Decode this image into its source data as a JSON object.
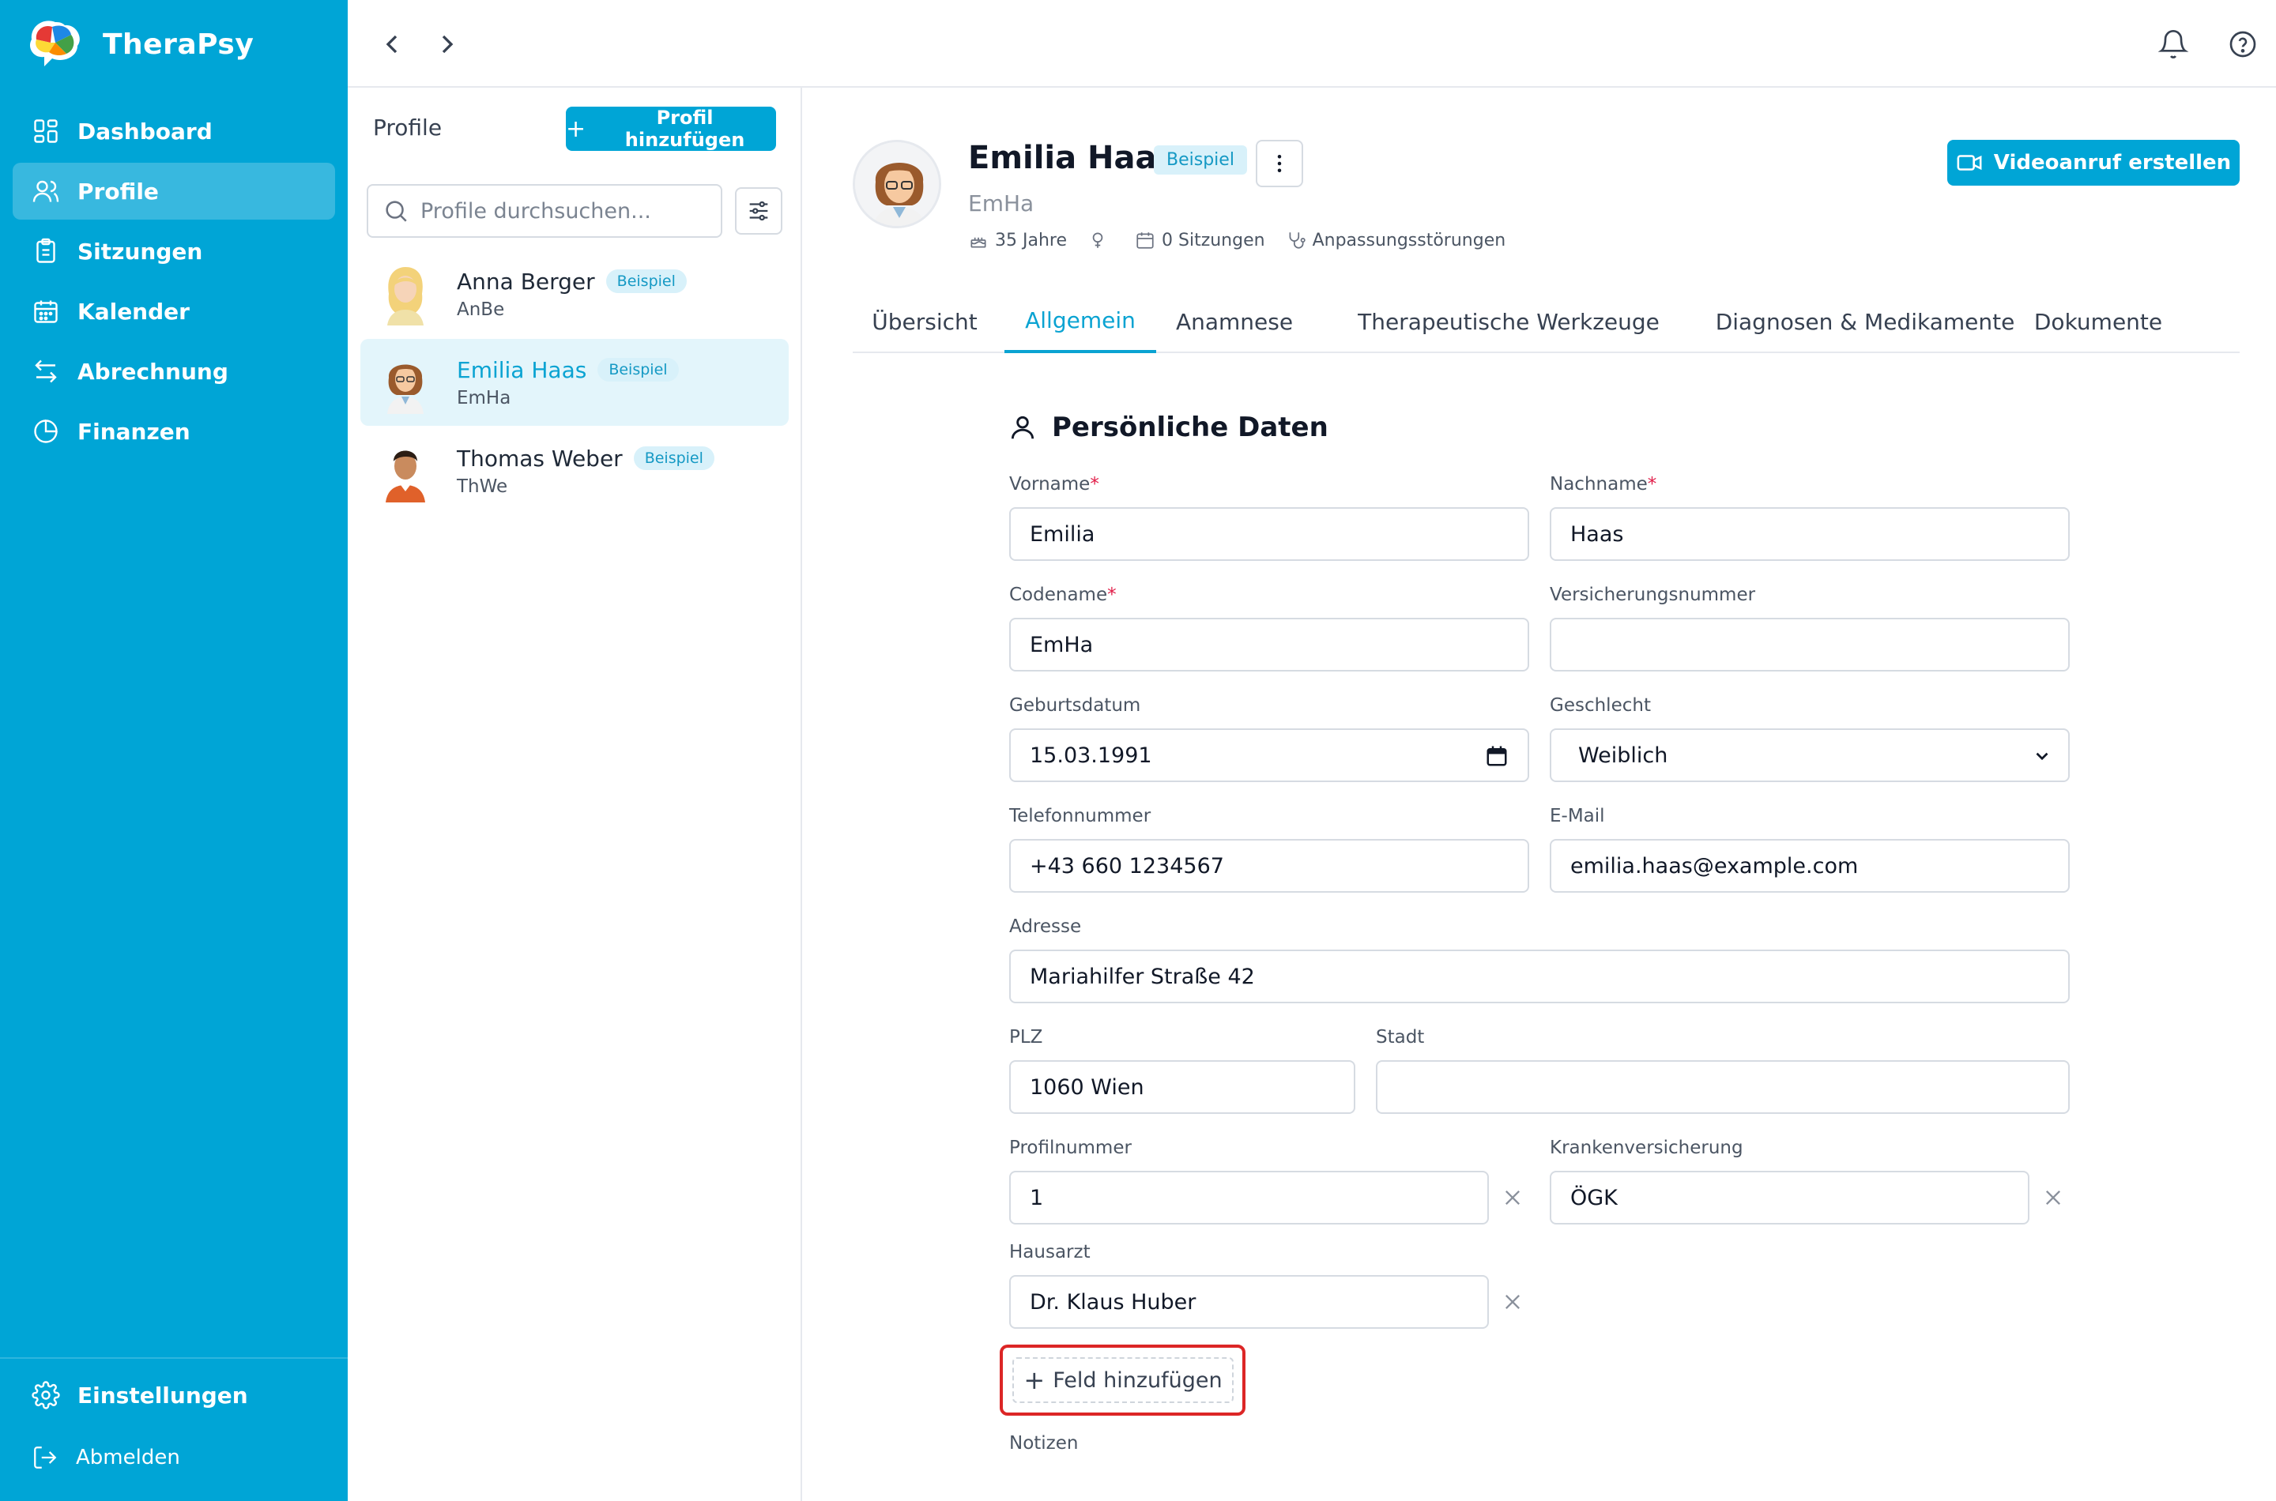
{
  "brand": {
    "name": "TheraPsy"
  },
  "nav": {
    "items": [
      {
        "label": "Dashboard",
        "icon": "dashboard-icon"
      },
      {
        "label": "Profile",
        "icon": "users-icon",
        "active": true
      },
      {
        "label": "Sitzungen",
        "icon": "clipboard-icon"
      },
      {
        "label": "Kalender",
        "icon": "calendar-icon"
      },
      {
        "label": "Abrechnung",
        "icon": "transfer-icon"
      },
      {
        "label": "Finanzen",
        "icon": "pie-chart-icon"
      }
    ],
    "settings": "Einstellungen",
    "logout": "Abmelden"
  },
  "list": {
    "title": "Profile",
    "add_label": "Profil hinzufügen",
    "search_placeholder": "Profile durchsuchen...",
    "profiles": [
      {
        "name": "Anna Berger",
        "code": "AnBe",
        "badge": "Beispiel"
      },
      {
        "name": "Emilia Haas",
        "code": "EmHa",
        "badge": "Beispiel",
        "active": true
      },
      {
        "name": "Thomas Weber",
        "code": "ThWe",
        "badge": "Beispiel"
      }
    ]
  },
  "profile": {
    "name": "Emilia Haas",
    "badge": "Beispiel",
    "code": "EmHa",
    "age": "35 Jahre",
    "sessions": "0 Sitzungen",
    "diagnosis": "Anpassungsstörungen",
    "video_label": "Videoanruf erstellen"
  },
  "tabs": [
    "Übersicht",
    "Allgemein",
    "Anamnese",
    "Therapeutische Werkzeuge",
    "Diagnosen & Medikamente",
    "Dokumente"
  ],
  "form": {
    "section_title": "Persönliche Daten",
    "vorname_label": "Vorname",
    "vorname": "Emilia",
    "nachname_label": "Nachname",
    "nachname": "Haas",
    "codename_label": "Codename",
    "codename": "EmHa",
    "versicherung_label": "Versicherungsnummer",
    "versicherung": "",
    "geburtsdatum_label": "Geburtsdatum",
    "geburtsdatum": "15.03.1991",
    "geschlecht_label": "Geschlecht",
    "geschlecht": "Weiblich",
    "telefon_label": "Telefonnummer",
    "telefon": "+43 660 1234567",
    "email_label": "E-Mail",
    "email": "emilia.haas@example.com",
    "adresse_label": "Adresse",
    "adresse": "Mariahilfer Straße 42",
    "plz_label": "PLZ",
    "plz": "1060 Wien",
    "stadt_label": "Stadt",
    "stadt": "",
    "profilnummer_label": "Profilnummer",
    "profilnummer": "1",
    "krankenversicherung_label": "Krankenversicherung",
    "krankenversicherung": "ÖGK",
    "hausarzt_label": "Hausarzt",
    "hausarzt": "Dr. Klaus Huber",
    "add_field_label": "Feld hinzufügen",
    "notizen_label": "Notizen",
    "required_mark": "*"
  },
  "colors": {
    "primary": "#00a5d6",
    "accent_text": "#0aa3d2",
    "badge_bg": "#d8f1fa",
    "highlight_border": "#dc2626"
  }
}
